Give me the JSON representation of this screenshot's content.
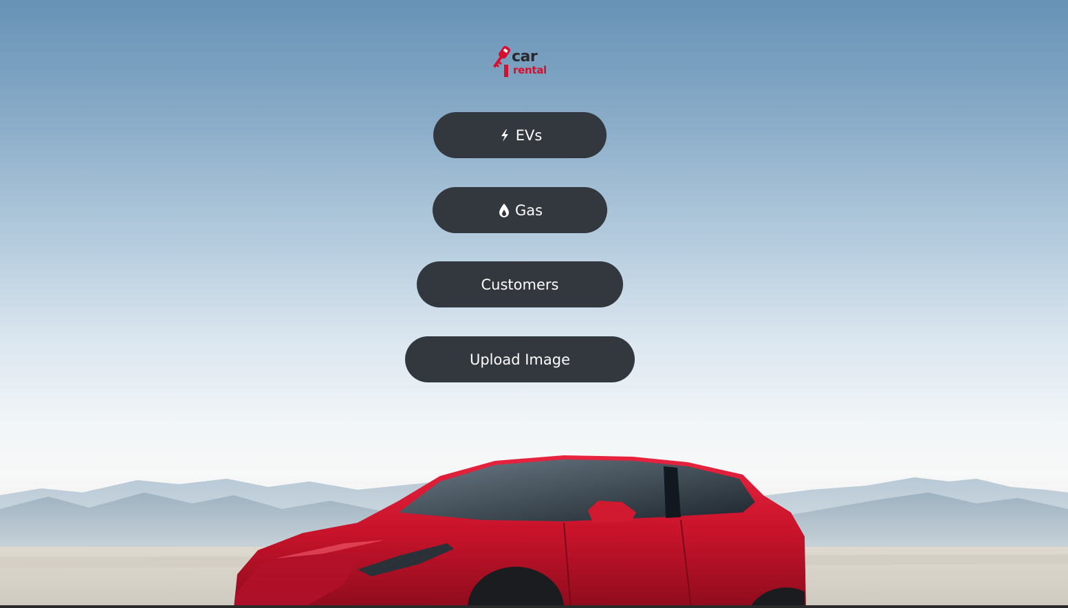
{
  "brand": {
    "logo_word_top": "car",
    "logo_word_bottom": "rental",
    "accent_color": "#d4102e",
    "dark_color": "#2a2a2e"
  },
  "navigation": {
    "buttons": [
      {
        "label": "EVs",
        "icon": "lightning-bolt-icon"
      },
      {
        "label": "Gas",
        "icon": "fuel-drop-icon"
      },
      {
        "label": "Customers",
        "icon": ""
      },
      {
        "label": "Upload Image",
        "icon": ""
      }
    ],
    "button_color": "#33373e",
    "button_text_color": "#ffffff"
  },
  "background": {
    "sky_top_color": "#6792b6",
    "car_color": "#d11a2f"
  }
}
